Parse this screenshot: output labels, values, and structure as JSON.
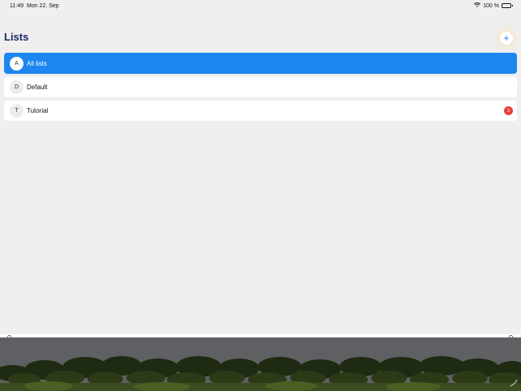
{
  "status_bar": {
    "time": "11:49",
    "date": "Mon 22. Sep",
    "battery": "100 %",
    "wifi_icon": "wifi-icon",
    "battery_icon": "battery-icon"
  },
  "header": {
    "title": "Lists",
    "add_label": "+"
  },
  "lists": [
    {
      "initial": "A",
      "name": "All lists",
      "selected": true
    },
    {
      "initial": "D",
      "name": "Default",
      "selected": false
    },
    {
      "initial": "T",
      "name": "Tutorial",
      "selected": false,
      "badge": "3"
    }
  ],
  "colors": {
    "accent": "#1e86f0",
    "title": "#1a2a66",
    "badge": "#e8413c",
    "background": "#efeff0"
  }
}
